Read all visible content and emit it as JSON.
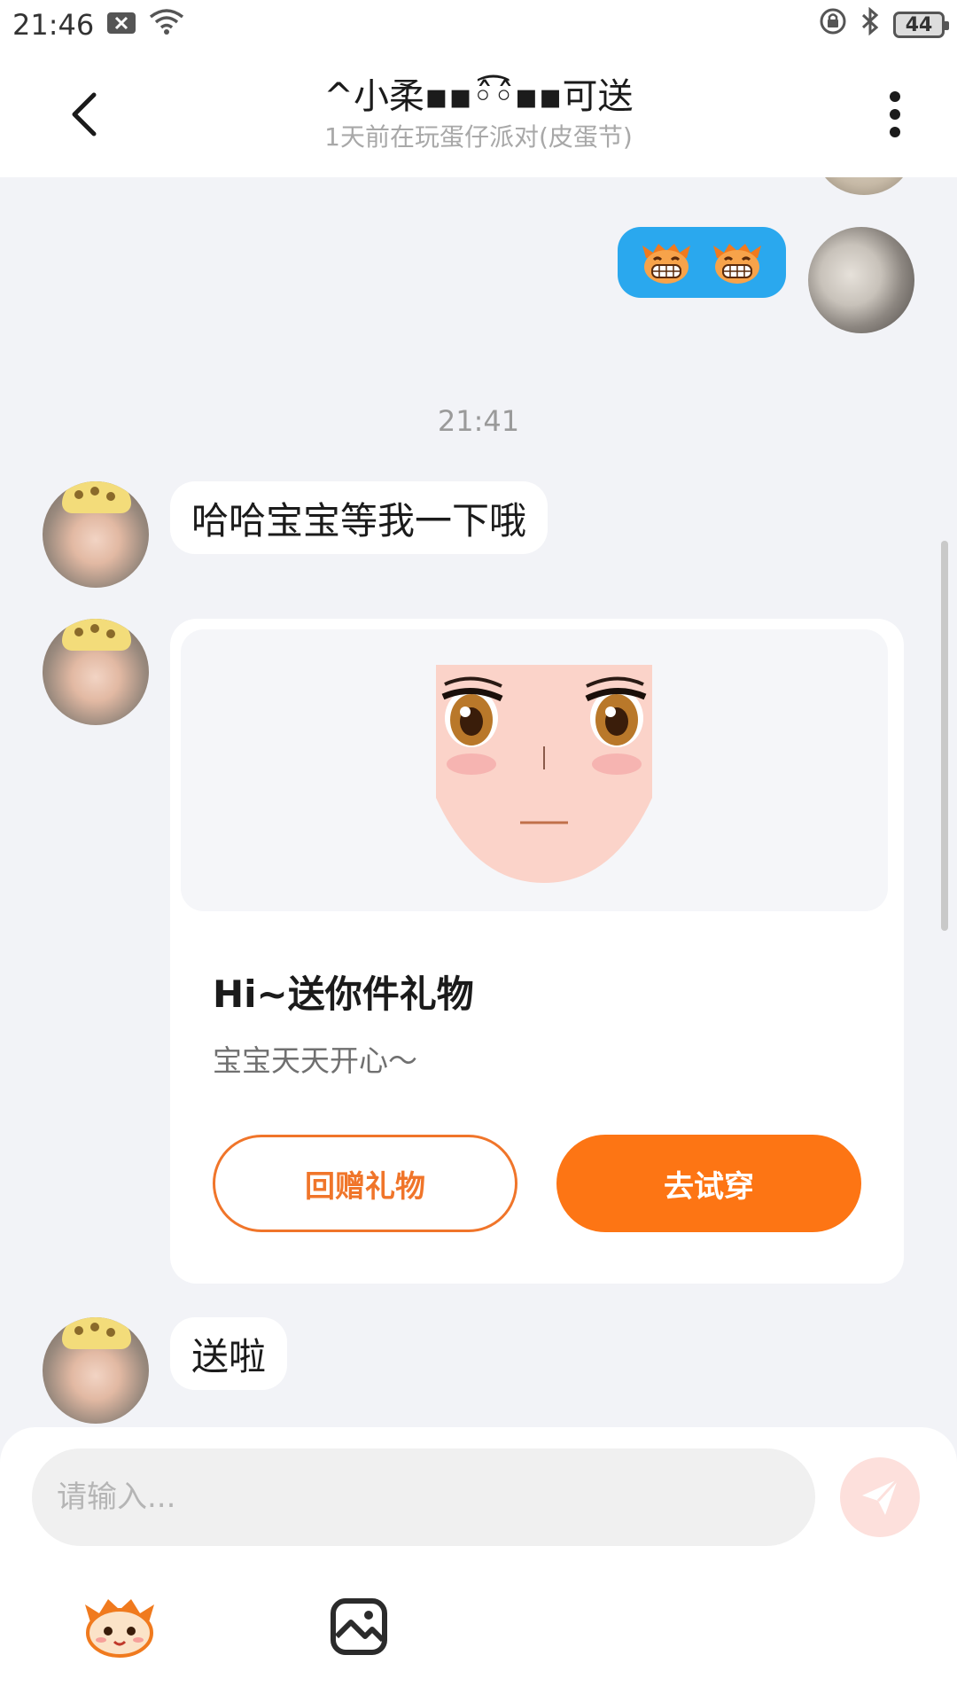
{
  "status_bar": {
    "time": "21:46",
    "battery": "44"
  },
  "header": {
    "title": "^小柔▪︎▪︎◦̂͡◦̂▪︎▪︎可送",
    "subtitle": "1天前在玩蛋仔派对(皮蛋节)"
  },
  "chat": {
    "timestamp": "21:41",
    "messages": [
      {
        "text": "哈哈宝宝等我一下哦"
      },
      {
        "text": "送啦"
      }
    ],
    "gift_card": {
      "title": "Hi~送你件礼物",
      "description": "宝宝天天开心～",
      "return_gift_label": "回赠礼物",
      "try_on_label": "去试穿"
    }
  },
  "input": {
    "placeholder": "请输入..."
  },
  "colors": {
    "accent": "#fd7514",
    "my_bubble": "#2aa8ee",
    "send_button_disabled": "#fde0dc"
  }
}
